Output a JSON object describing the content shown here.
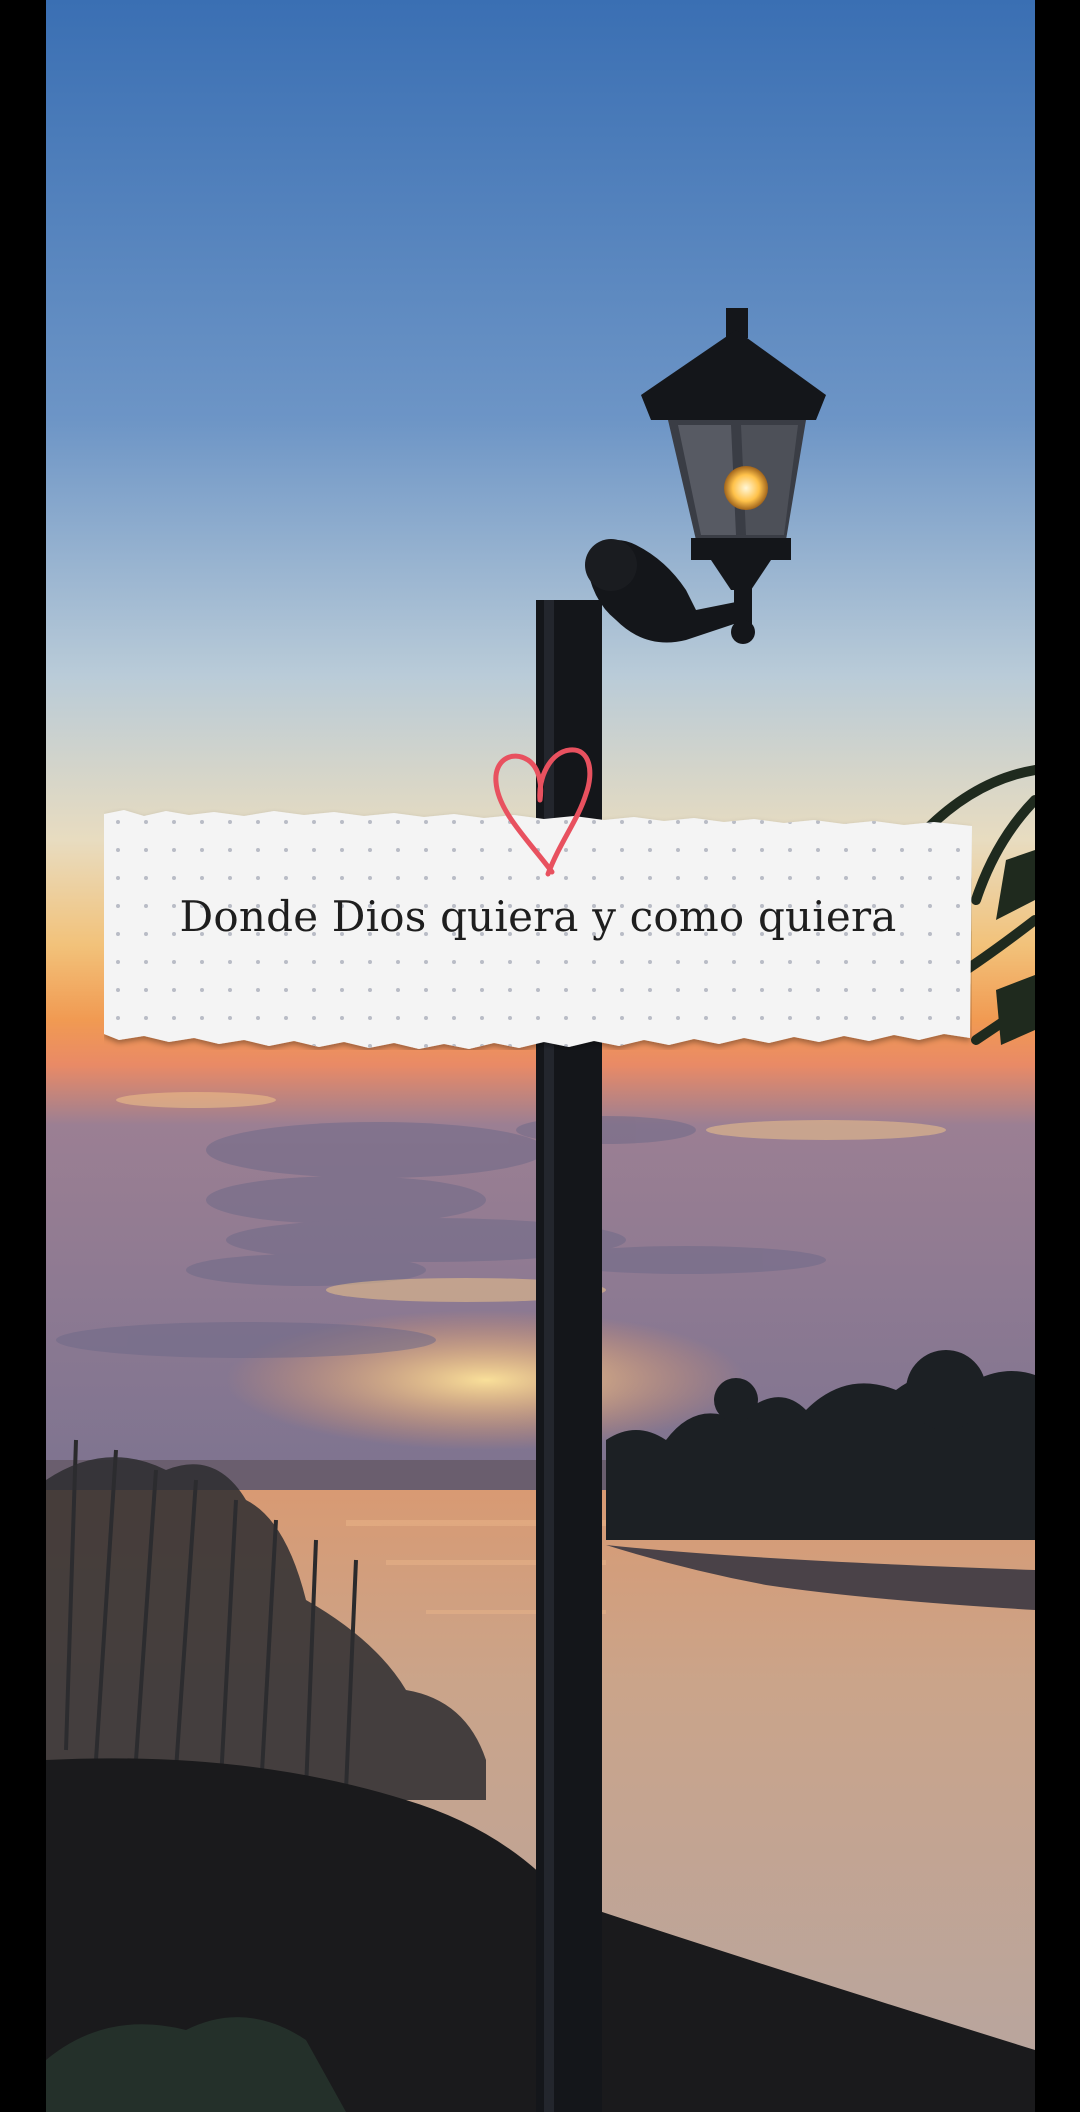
{
  "caption": {
    "text": "Donde Dios quiera y como quiera"
  },
  "colors": {
    "sky_top": "#3f74b8",
    "sky_mid": "#a9bfd2",
    "horizon": "#f08a45",
    "water": "#c79a7c",
    "note_paper": "#f4f4f4",
    "note_dots": "#b9bcc6",
    "heart": "#e8515f",
    "frame": "#000000"
  },
  "icons": {
    "heart": "heart-doodle-icon"
  }
}
